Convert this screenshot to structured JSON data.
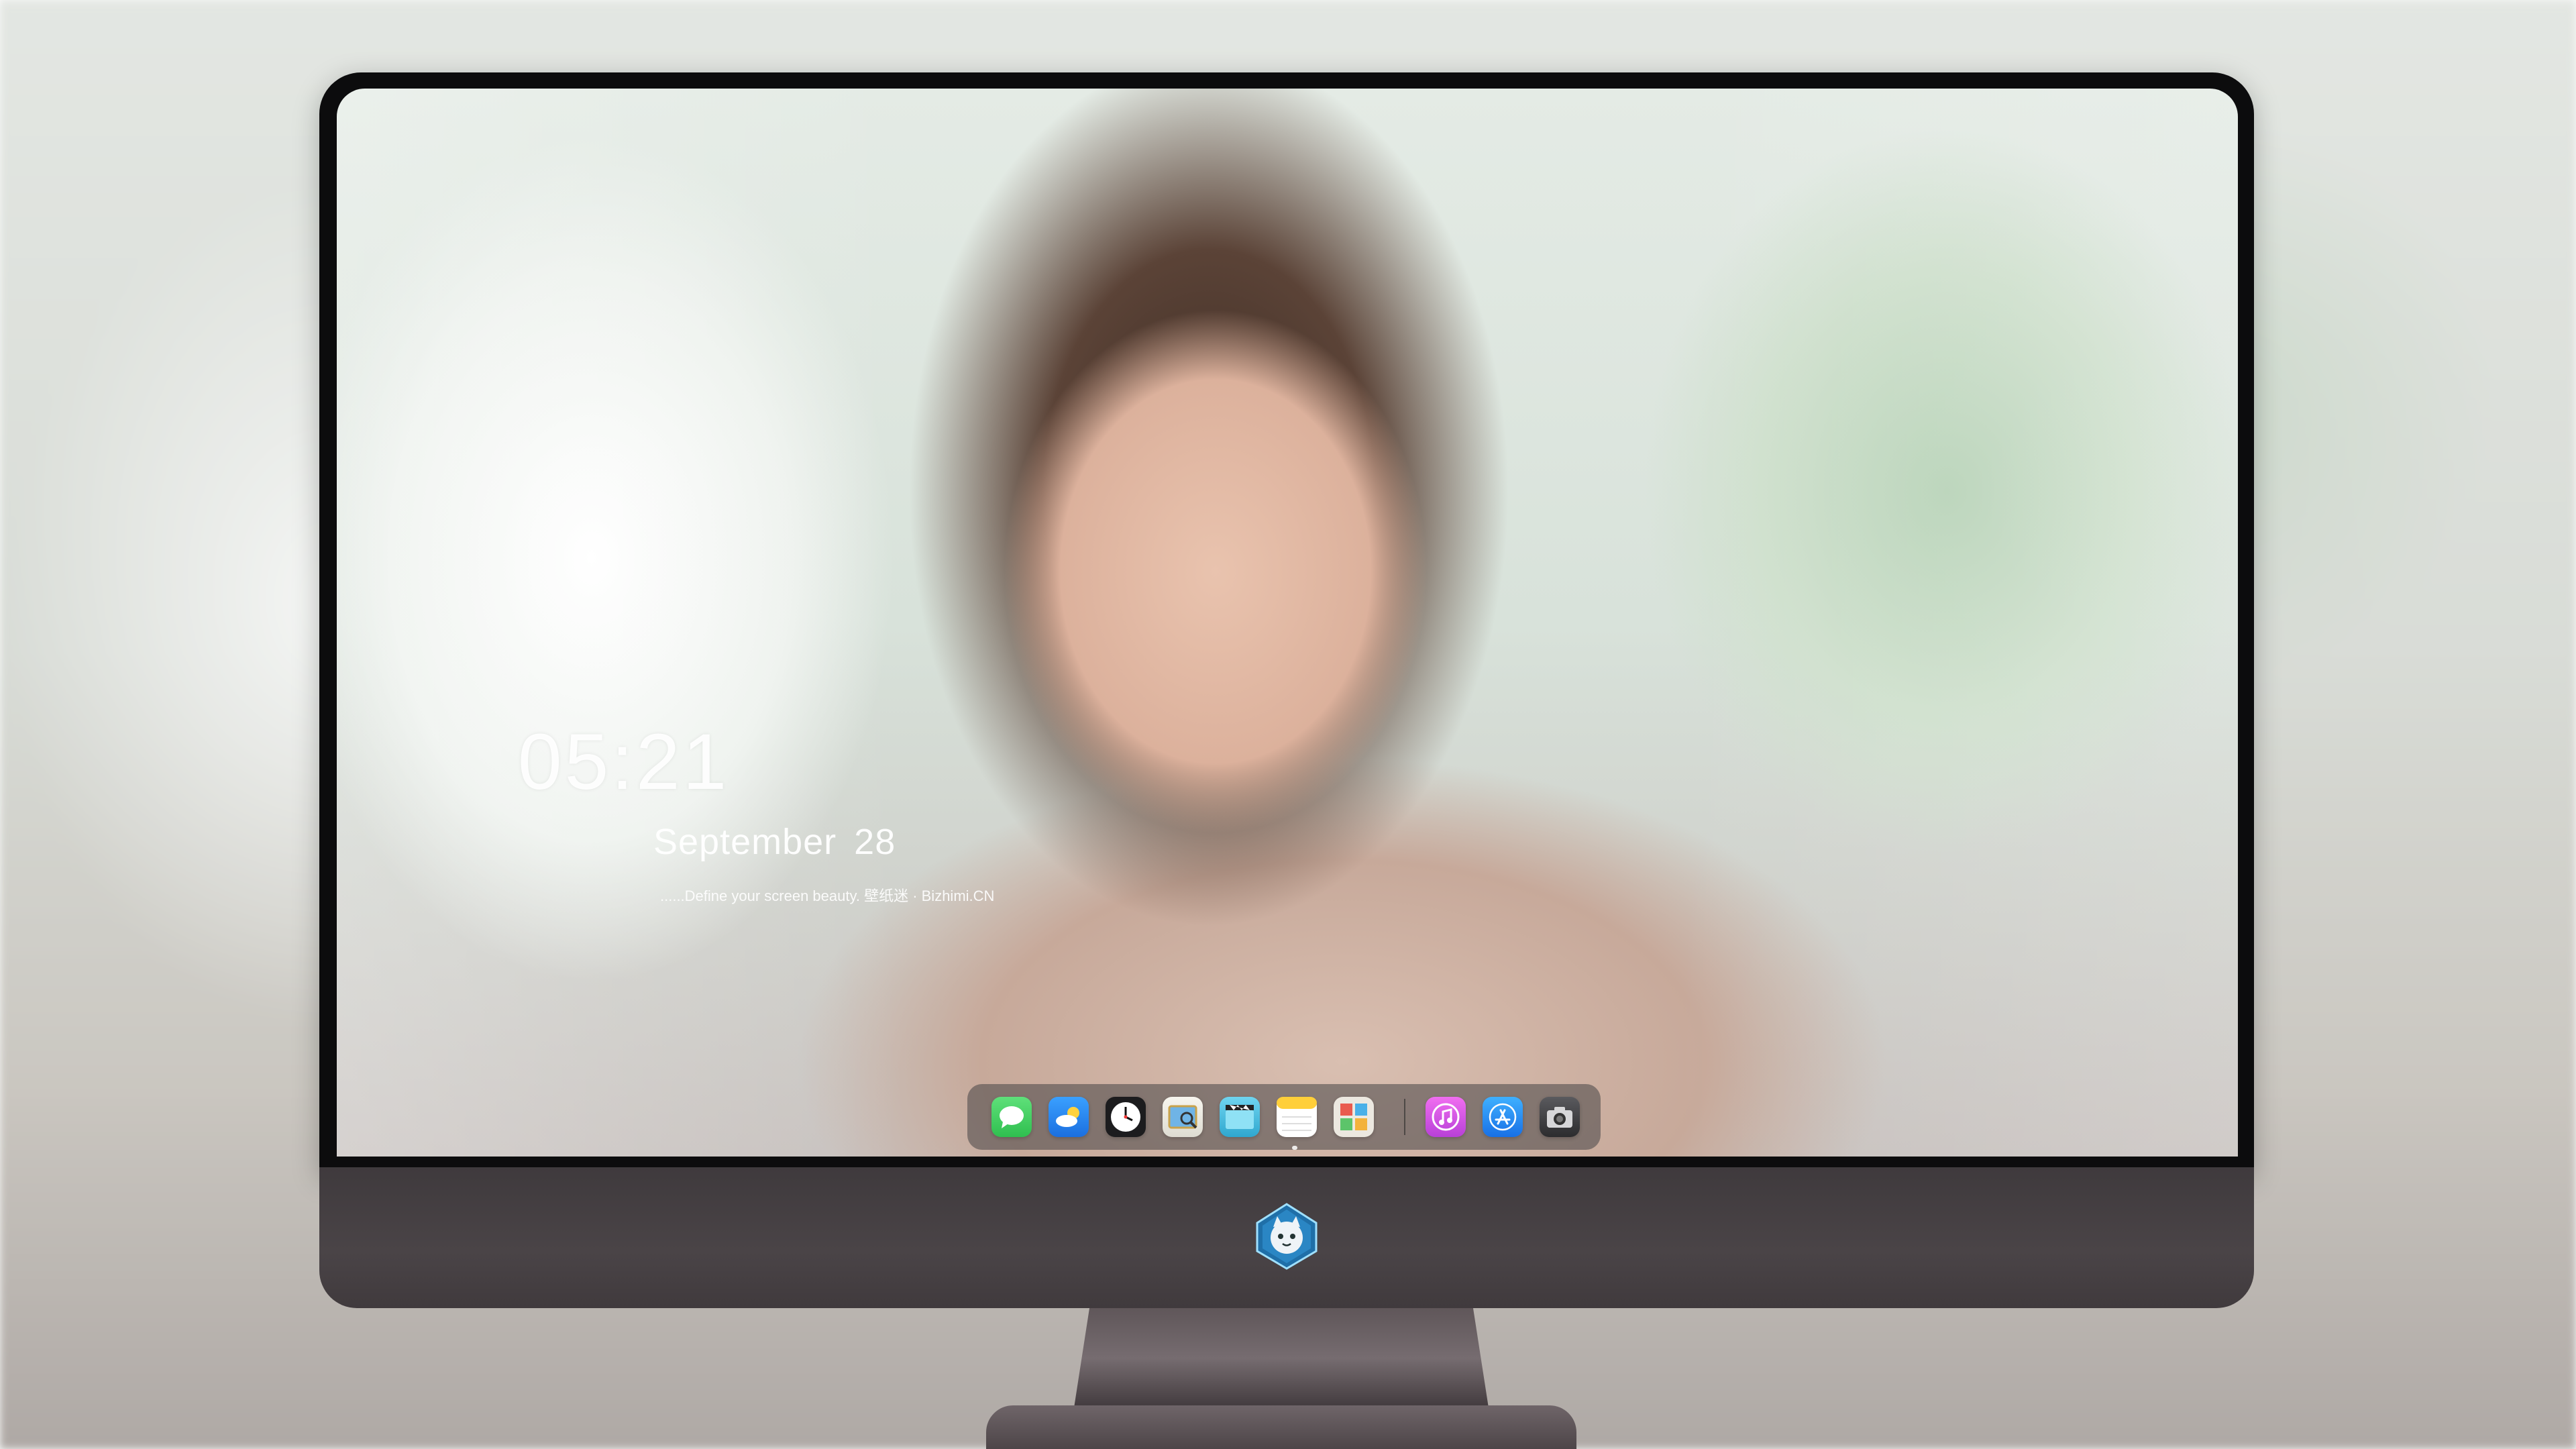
{
  "lockscreen": {
    "time": "05:21",
    "month": "September",
    "day": "28",
    "tagline": "......Define your screen beauty. 壁纸迷 · Bizhimi.CN"
  },
  "dock": {
    "items": [
      {
        "name": "messages-icon",
        "color": "#34c759"
      },
      {
        "name": "weather-icon",
        "color": "#2e8cf5"
      },
      {
        "name": "clock-icon",
        "color": "#1c1c1e"
      },
      {
        "name": "preview-icon",
        "color": "#f2f2ef"
      },
      {
        "name": "final-cut-icon",
        "color": "#4fc3e0"
      },
      {
        "name": "notes-icon",
        "color": "#ffd54a"
      },
      {
        "name": "photo-booth-icon",
        "color": "#e9e6df"
      },
      {
        "name": "itunes-icon",
        "color": "#e44ce0"
      },
      {
        "name": "app-store-icon",
        "color": "#1f8cf0"
      },
      {
        "name": "camera-icon",
        "color": "#3a3a3c"
      }
    ]
  }
}
